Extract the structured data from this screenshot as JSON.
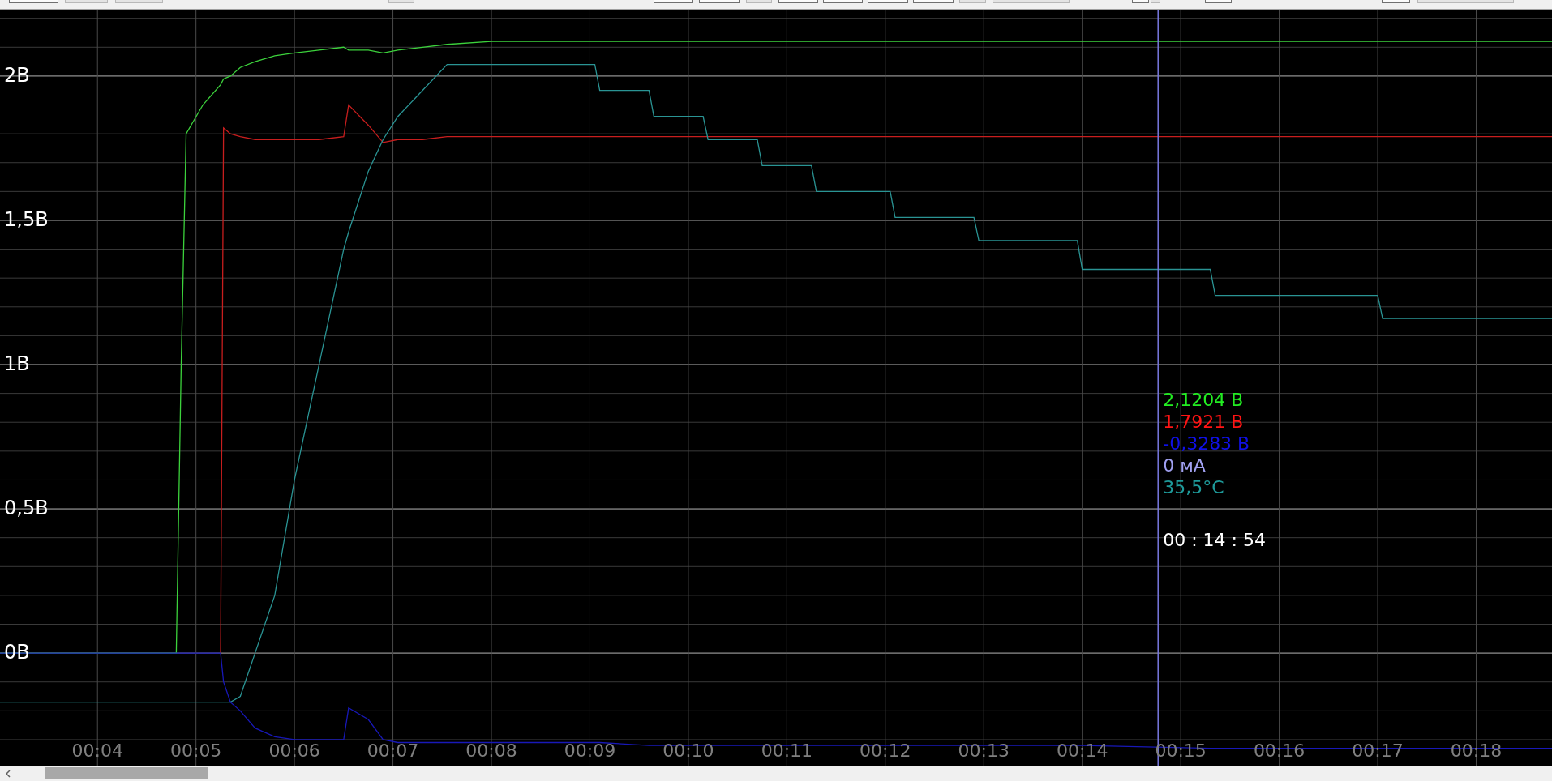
{
  "chart": {
    "chart_data": {
      "type": "line",
      "x": [
        3.01,
        4.8,
        4.85,
        4.9,
        5.07,
        5.25,
        5.28,
        5.35,
        5.45,
        5.6,
        5.8,
        6.0,
        6.25,
        6.5,
        6.55,
        6.75,
        6.9,
        7.05,
        7.3,
        7.55,
        8.0,
        9.05,
        9.1,
        9.6,
        9.65,
        10.15,
        10.2,
        10.7,
        10.75,
        11.25,
        11.3,
        12.05,
        12.1,
        12.9,
        12.95,
        13.95,
        14.0,
        15.3,
        15.35,
        17.0,
        17.05,
        18.77
      ],
      "series": [
        {
          "color": "#3cd23c",
          "values": [
            0,
            0,
            1.0,
            1.8,
            1.9,
            1.97,
            1.99,
            2.0,
            2.03,
            2.05,
            2.07,
            2.08,
            2.09,
            2.1,
            2.09,
            2.09,
            2.08,
            2.09,
            2.1,
            2.11,
            2.12,
            2.12,
            2.12,
            2.12,
            2.12,
            2.12,
            2.12,
            2.12,
            2.12,
            2.12,
            2.12,
            2.12,
            2.12,
            2.12,
            2.12,
            2.12,
            2.12,
            2.12,
            2.12,
            2.12,
            2.12,
            2.12
          ]
        },
        {
          "color": "#c81e1e",
          "values": [
            null,
            null,
            null,
            null,
            null,
            0,
            1.82,
            1.8,
            1.79,
            1.78,
            1.78,
            1.78,
            1.78,
            1.79,
            1.9,
            1.83,
            1.77,
            1.78,
            1.78,
            1.79,
            1.79,
            1.79,
            1.79,
            1.79,
            1.79,
            1.79,
            1.79,
            1.79,
            1.79,
            1.79,
            1.79,
            1.79,
            1.79,
            1.79,
            1.79,
            1.79,
            1.79,
            1.79,
            1.79,
            1.79,
            1.79,
            1.79
          ]
        },
        {
          "color": "#1818b8",
          "values": [
            0,
            0,
            0,
            0,
            0,
            0,
            -0.1,
            -0.17,
            -0.2,
            -0.26,
            -0.29,
            -0.3,
            -0.3,
            -0.3,
            -0.19,
            -0.23,
            -0.3,
            -0.31,
            -0.31,
            -0.31,
            -0.31,
            -0.31,
            -0.31,
            -0.32,
            -0.32,
            -0.32,
            -0.32,
            -0.32,
            -0.32,
            -0.32,
            -0.32,
            -0.32,
            -0.32,
            -0.32,
            -0.32,
            -0.32,
            -0.32,
            -0.33,
            -0.33,
            -0.33,
            -0.33,
            -0.33
          ]
        },
        {
          "color": "#2a9494",
          "values": [
            -0.17,
            -0.17,
            -0.17,
            -0.17,
            -0.17,
            -0.17,
            -0.17,
            -0.17,
            -0.15,
            0,
            0.2,
            0.6,
            1.0,
            1.4,
            1.46,
            1.67,
            1.78,
            1.86,
            1.95,
            2.04,
            2.04,
            2.04,
            1.95,
            1.95,
            1.86,
            1.86,
            1.78,
            1.78,
            1.69,
            1.69,
            1.6,
            1.6,
            1.51,
            1.51,
            1.43,
            1.43,
            1.33,
            1.33,
            1.24,
            1.24,
            1.16,
            1.16
          ]
        }
      ],
      "xlim": [
        3.01,
        18.77
      ],
      "ylim": [
        -0.39,
        2.23
      ],
      "xticks": [
        {
          "value": 4,
          "label": "00:04"
        },
        {
          "value": 5,
          "label": "00:05"
        },
        {
          "value": 6,
          "label": "00:06"
        },
        {
          "value": 7,
          "label": "00:07"
        },
        {
          "value": 8,
          "label": "00:08"
        },
        {
          "value": 9,
          "label": "00:09"
        },
        {
          "value": 10,
          "label": "00:10"
        },
        {
          "value": 11,
          "label": "00:11"
        },
        {
          "value": 12,
          "label": "00:12"
        },
        {
          "value": 13,
          "label": "00:13"
        },
        {
          "value": 14,
          "label": "00:14"
        },
        {
          "value": 15,
          "label": "00:15"
        },
        {
          "value": 16,
          "label": "00:16"
        },
        {
          "value": 17,
          "label": "00:17"
        },
        {
          "value": 18,
          "label": "00:18"
        }
      ],
      "yticks": [
        {
          "value": 0,
          "label": "0В"
        },
        {
          "value": 0.5,
          "label": "0,5В"
        },
        {
          "value": 1,
          "label": "1В"
        },
        {
          "value": 1.5,
          "label": "1,5В"
        },
        {
          "value": 2,
          "label": "2В"
        }
      ],
      "grid": true,
      "ref_lines": [
        {
          "axis": "x",
          "value": 14.77
        }
      ]
    },
    "readouts": [
      {
        "text": "2,1204 В",
        "color": "#22ee22"
      },
      {
        "text": "1,7921 В",
        "color": "#ff1414"
      },
      {
        "text": "-0,3283 В",
        "color": "#1010e8"
      },
      {
        "text": "0 мА",
        "color": "#a0a0f0"
      },
      {
        "text": "35,5°C",
        "color": "#1e9a9a"
      }
    ],
    "cursor_time": "00 : 14 : 54"
  }
}
